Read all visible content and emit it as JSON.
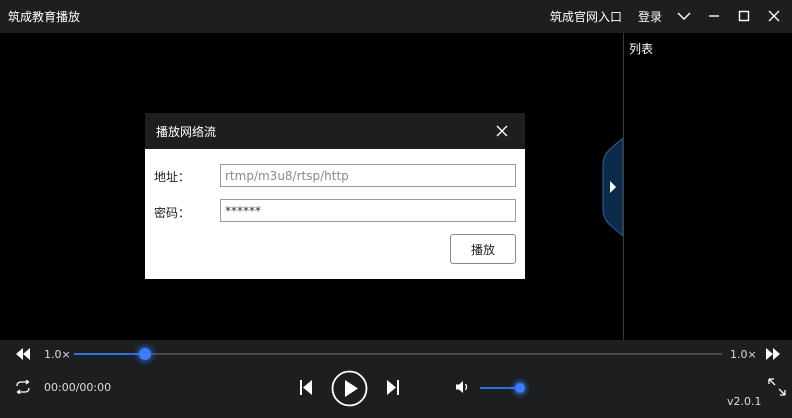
{
  "app": {
    "title": "筑成教育播放",
    "official_link": "筑成官网入口",
    "login": "登录"
  },
  "list_panel": {
    "title": "列表"
  },
  "dialog": {
    "title": "播放网络流",
    "address_label": "地址：",
    "address_placeholder": "rtmp/m3u8/rtsp/http",
    "password_label": "密码：",
    "password_value": "******",
    "play_button": "播放"
  },
  "controls": {
    "speed_left": "1.0×",
    "speed_right": "1.0×",
    "time": "00:00/00:00",
    "version": "v2.0.1",
    "progress_fraction": 0.11,
    "volume_fraction": 0.9
  },
  "colors": {
    "accent": "#3a7dff",
    "bar_bg": "#1c1e1f"
  },
  "icons": [
    "dropdown-chevron-icon",
    "minimize-icon",
    "maximize-icon",
    "close-icon",
    "rewind-icon",
    "fast-forward-icon",
    "loop-icon",
    "previous-icon",
    "play-icon",
    "next-icon",
    "volume-icon",
    "fullscreen-icon"
  ]
}
